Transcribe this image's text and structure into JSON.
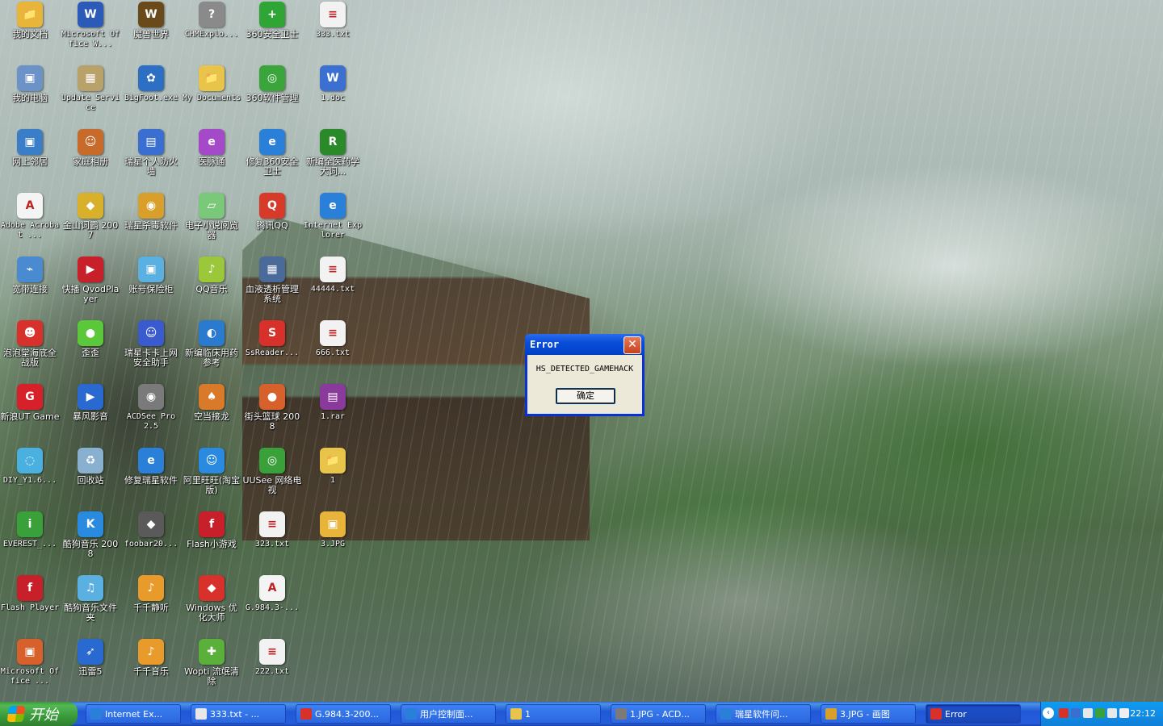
{
  "desktop": {
    "icons": [
      {
        "label": "我的文档",
        "color": "#e8b43a",
        "glyph": "📁",
        "icon_name": "my-documents-icon"
      },
      {
        "label": "Microsoft Office W...",
        "color": "#2b5ab8",
        "glyph": "W",
        "icon_name": "word-icon"
      },
      {
        "label": "魔兽世界",
        "color": "#6a4a1a",
        "glyph": "W",
        "icon_name": "wow-icon"
      },
      {
        "label": "CHMExplo...",
        "color": "#8a8a8a",
        "glyph": "?",
        "icon_name": "chm-icon"
      },
      {
        "label": "360安全卫士",
        "color": "#2fa535",
        "glyph": "+",
        "icon_name": "360-safe-icon"
      },
      {
        "label": "333.txt",
        "color": "#f2f2f2",
        "glyph": "≡",
        "icon_name": "text-file-icon"
      },
      {
        "label": "我的电脑",
        "color": "#6c93c8",
        "glyph": "▣",
        "icon_name": "my-computer-icon"
      },
      {
        "label": "Update Service",
        "color": "#b8a26a",
        "glyph": "▦",
        "icon_name": "update-service-icon"
      },
      {
        "label": "BigFoot.exe",
        "color": "#2e6fc6",
        "glyph": "✿",
        "icon_name": "bigfoot-icon"
      },
      {
        "label": "My Documents",
        "color": "#e8c44a",
        "glyph": "📁",
        "icon_name": "folder-icon"
      },
      {
        "label": "360软件管理",
        "color": "#3aa53a",
        "glyph": "◎",
        "icon_name": "360-software-icon"
      },
      {
        "label": "1.doc",
        "color": "#3b6fd0",
        "glyph": "W",
        "icon_name": "doc-file-icon"
      },
      {
        "label": "网上邻居",
        "color": "#3a7ec8",
        "glyph": "▣",
        "icon_name": "network-icon"
      },
      {
        "label": "家庭相册",
        "color": "#c86a2a",
        "glyph": "☺",
        "icon_name": "family-album-icon"
      },
      {
        "label": "瑞星个人防火墙",
        "color": "#3a6ed0",
        "glyph": "▤",
        "icon_name": "firewall-icon"
      },
      {
        "label": "医脉通",
        "color": "#a44ac8",
        "glyph": "e",
        "icon_name": "yimaitong-icon"
      },
      {
        "label": "修复360安全卫士",
        "color": "#2a7fd8",
        "glyph": "e",
        "icon_name": "ie-icon"
      },
      {
        "label": "新编全医药学大词...",
        "color": "#2a8a2a",
        "glyph": "R",
        "icon_name": "dictionary-icon"
      },
      {
        "label": "Adobe Acrobat ...",
        "color": "#f4f4f4",
        "glyph": "A",
        "icon_name": "acrobat-icon"
      },
      {
        "label": "金山词霸 2007",
        "color": "#d8b02a",
        "glyph": "◆",
        "icon_name": "kingsoft-icon"
      },
      {
        "label": "瑞星杀毒软件",
        "color": "#d8a02a",
        "glyph": "◉",
        "icon_name": "rising-av-icon"
      },
      {
        "label": "电子小说阅览器",
        "color": "#7ac87a",
        "glyph": "▱",
        "icon_name": "ebook-icon"
      },
      {
        "label": "腾讯QQ",
        "color": "#d83a2a",
        "glyph": "Q",
        "icon_name": "qq-icon"
      },
      {
        "label": "Internet Explorer",
        "color": "#2a7fd8",
        "glyph": "e",
        "icon_name": "internet-explorer-icon"
      },
      {
        "label": "宽带连接",
        "color": "#4a8ad0",
        "glyph": "⌁",
        "icon_name": "broadband-icon"
      },
      {
        "label": "快播 QvodPlayer",
        "color": "#c8202a",
        "glyph": "▶",
        "icon_name": "qvod-icon"
      },
      {
        "label": "账号保险柜",
        "color": "#5ab0e0",
        "glyph": "▣",
        "icon_name": "account-safe-icon"
      },
      {
        "label": "QQ音乐",
        "color": "#9ac83a",
        "glyph": "♪",
        "icon_name": "qq-music-icon"
      },
      {
        "label": "血液透析管理系统",
        "color": "#4a6a9a",
        "glyph": "▦",
        "icon_name": "dialysis-icon"
      },
      {
        "label": "44444.txt",
        "color": "#f2f2f2",
        "glyph": "≡",
        "icon_name": "text-file-icon"
      },
      {
        "label": "泡泡堂海底全战版",
        "color": "#d8302a",
        "glyph": "☻",
        "icon_name": "bnb-icon"
      },
      {
        "label": "歪歪",
        "color": "#5ac83a",
        "glyph": "●",
        "icon_name": "yy-icon"
      },
      {
        "label": "瑞星卡卡上网安全助手",
        "color": "#3a5ad0",
        "glyph": "☺",
        "icon_name": "kaka-icon"
      },
      {
        "label": "新编临床用药参考",
        "color": "#2a7ad0",
        "glyph": "◐",
        "icon_name": "drug-ref-icon"
      },
      {
        "label": "SsReader...",
        "color": "#d8302a",
        "glyph": "S",
        "icon_name": "ssreader-icon"
      },
      {
        "label": "666.txt",
        "color": "#f2f2f2",
        "glyph": "≡",
        "icon_name": "text-file-icon"
      },
      {
        "label": "新浪UT Game",
        "color": "#d8202a",
        "glyph": "G",
        "icon_name": "sina-game-icon"
      },
      {
        "label": "暴风影音",
        "color": "#2a6ad0",
        "glyph": "▶",
        "icon_name": "baofeng-icon"
      },
      {
        "label": "ACDSee Pro 2.5",
        "color": "#7a7a7a",
        "glyph": "◉",
        "icon_name": "acdsee-icon"
      },
      {
        "label": "空当接龙",
        "color": "#d87a2a",
        "glyph": "♠",
        "icon_name": "freecell-icon"
      },
      {
        "label": "街头篮球 2008",
        "color": "#d8602a",
        "glyph": "●",
        "icon_name": "basketball-icon"
      },
      {
        "label": "1.rar",
        "color": "#8a3a9a",
        "glyph": "▤",
        "icon_name": "rar-file-icon"
      },
      {
        "label": "DIY_Y1.6...",
        "color": "#4ab0e0",
        "glyph": "◌",
        "icon_name": "diy-icon"
      },
      {
        "label": "回收站",
        "color": "#8ab0d0",
        "glyph": "♻",
        "icon_name": "recycle-bin-icon"
      },
      {
        "label": "修复瑞星软件",
        "color": "#2a7fd8",
        "glyph": "e",
        "icon_name": "ie-icon"
      },
      {
        "label": "阿里旺旺(淘宝版)",
        "color": "#2a8ae0",
        "glyph": "☺",
        "icon_name": "aliwangwang-icon"
      },
      {
        "label": "UUSee 网络电视",
        "color": "#3aa03a",
        "glyph": "◎",
        "icon_name": "uusee-icon"
      },
      {
        "label": "1",
        "color": "#e8c44a",
        "glyph": "📁",
        "icon_name": "folder-icon"
      },
      {
        "label": "EVEREST_...",
        "color": "#3aa03a",
        "glyph": "i",
        "icon_name": "everest-icon"
      },
      {
        "label": "酷狗音乐 2008",
        "color": "#2a8ae0",
        "glyph": "K",
        "icon_name": "kugou-icon"
      },
      {
        "label": "foobar20...",
        "color": "#5a5a5a",
        "glyph": "◆",
        "icon_name": "foobar-icon"
      },
      {
        "label": "Flash小游戏",
        "color": "#c8202a",
        "glyph": "f",
        "icon_name": "flash-game-icon"
      },
      {
        "label": "323.txt",
        "color": "#f2f2f2",
        "glyph": "≡",
        "icon_name": "text-file-icon"
      },
      {
        "label": "3.JPG",
        "color": "#e8b43a",
        "glyph": "▣",
        "icon_name": "jpg-file-icon"
      },
      {
        "label": "Flash Player",
        "color": "#c8202a",
        "glyph": "f",
        "icon_name": "flash-player-icon"
      },
      {
        "label": "酷狗音乐文件夹",
        "color": "#5ab0e0",
        "glyph": "♫",
        "icon_name": "kugou-folder-icon"
      },
      {
        "label": "千千静听",
        "color": "#e89a2a",
        "glyph": "♪",
        "icon_name": "ttplayer-icon"
      },
      {
        "label": "Windows 优化大师",
        "color": "#d8302a",
        "glyph": "◆",
        "icon_name": "optimizer-icon"
      },
      {
        "label": "G.984.3-...",
        "color": "#f4f4f4",
        "glyph": "A",
        "icon_name": "pdf-file-icon"
      },
      {
        "label": "",
        "color": "",
        "glyph": "",
        "icon_name": ""
      },
      {
        "label": "Microsoft Office ...",
        "color": "#d8602a",
        "glyph": "▣",
        "icon_name": "office-icon"
      },
      {
        "label": "迅雷5",
        "color": "#2a6ad0",
        "glyph": "➶",
        "icon_name": "xunlei-icon"
      },
      {
        "label": "千千音乐",
        "color": "#e89a2a",
        "glyph": "♪",
        "icon_name": "qianqian-music-icon"
      },
      {
        "label": "Wopti 流氓清除",
        "color": "#5ab03a",
        "glyph": "✚",
        "icon_name": "wopti-icon"
      },
      {
        "label": "222.txt",
        "color": "#f2f2f2",
        "glyph": "≡",
        "icon_name": "text-file-icon"
      },
      {
        "label": "",
        "color": "",
        "glyph": "",
        "icon_name": ""
      }
    ]
  },
  "dialog": {
    "title": "Error",
    "close_glyph": "✕",
    "message": "HS_DETECTED_GAMEHACK",
    "ok_label": "确定"
  },
  "taskbar": {
    "start_label": "开始",
    "tasks": [
      {
        "label": "Internet Ex...",
        "color": "#2a7fd8"
      },
      {
        "label": "333.txt - ...",
        "color": "#e8e8e8"
      },
      {
        "label": "G.984.3-200...",
        "color": "#d8302a"
      },
      {
        "label": "用户控制面...",
        "color": "#2a7fd8"
      },
      {
        "label": "1",
        "color": "#e8c44a"
      },
      {
        "label": "1.JPG - ACD...",
        "color": "#7a7a7a"
      },
      {
        "label": "瑞星软件问...",
        "color": "#2a7fd8"
      },
      {
        "label": "3.JPG - 画图",
        "color": "#d8a02a"
      },
      {
        "label": "Error",
        "color": "#d8302a",
        "active": true
      }
    ],
    "tray_chevron": "‹",
    "tray_icon_colors": [
      "#d8302a",
      "#3a6ed0",
      "#e8e8e8",
      "#3aa03a",
      "#e8e8e8",
      "#f0f0f0"
    ],
    "clock": "22:12"
  }
}
